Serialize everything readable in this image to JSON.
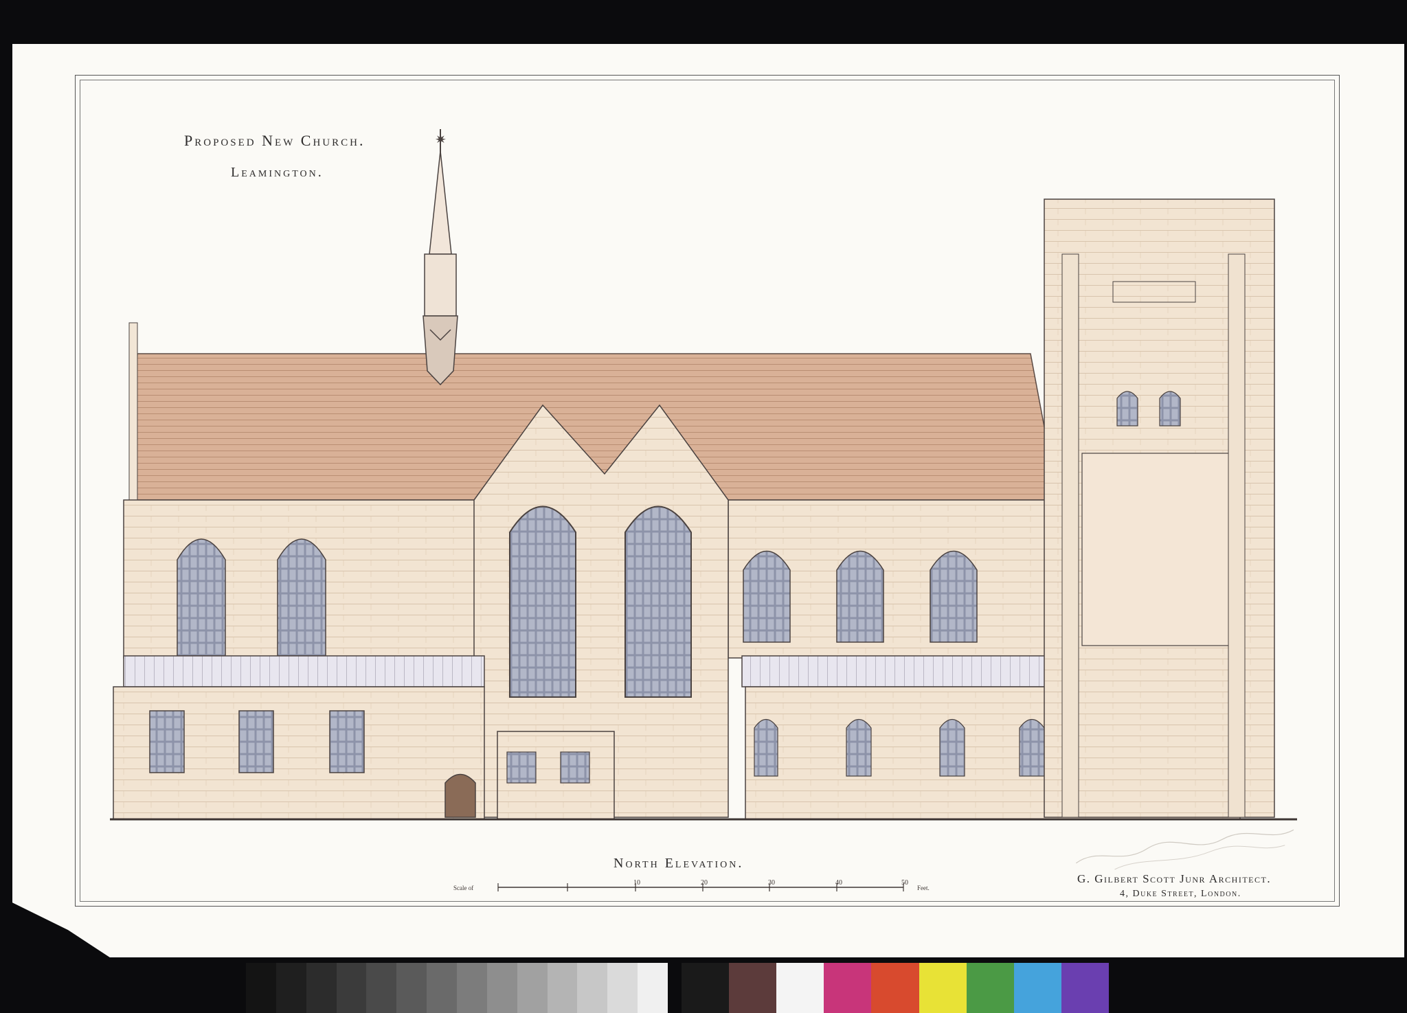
{
  "sheet": {
    "title_line1": "Proposed New Church.",
    "title_line2": "Leamington.",
    "elevation_label": "North Elevation.",
    "architect_line1": "G. Gilbert Scott Junr Architect.",
    "architect_line2": "4, Duke Street, London.",
    "scale_label": "Scale of",
    "scale_unit": "Feet.",
    "scale_ticks": [
      "10",
      "20",
      "30",
      "40",
      "50"
    ]
  },
  "colors": {
    "roof": "#d8ad90",
    "stone": "#f1e2cf",
    "stone_dark": "#e3cdb4",
    "glass": "#8e93a8",
    "ink": "#4a4240",
    "paper": "#fbfaf6",
    "background": "#0b0b0d"
  },
  "color_chart": {
    "grays": [
      "#141414",
      "#1f1f1f",
      "#2c2c2c",
      "#3b3b3b",
      "#4a4a4a",
      "#5a5a5a",
      "#6a6a6a",
      "#7c7c7c",
      "#8e8e8e",
      "#a1a1a1",
      "#b4b4b4",
      "#c7c7c7",
      "#dadada",
      "#f0f0f0"
    ],
    "colors": [
      "#1a1a1a",
      "#5c3b3b",
      "#f4f4f4",
      "#c8357a",
      "#d84a2e",
      "#e8e236",
      "#4b9a45",
      "#45a3dc",
      "#6a3fb0"
    ]
  }
}
